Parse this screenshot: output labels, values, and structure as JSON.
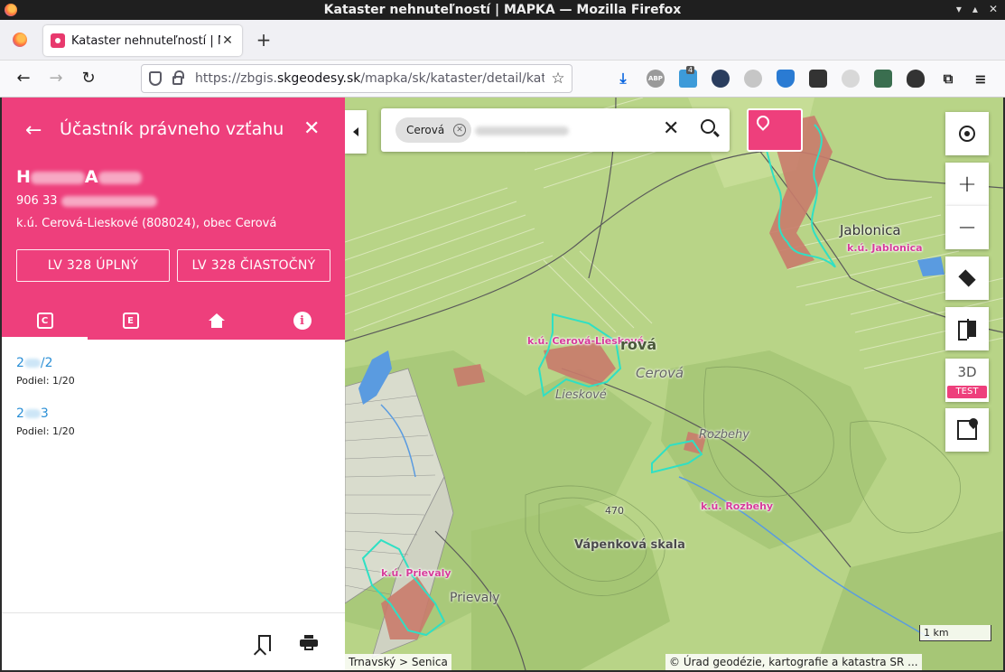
{
  "window": {
    "title": "Kataster nehnuteľností | MAPKA — Mozilla Firefox"
  },
  "browser": {
    "tab_title": "Kataster nehnuteľností | MAPKA",
    "url_prefix": "https://zbgis.",
    "url_domain": "skgeodesy.sk",
    "url_path": "/mapka/sk/kataster/detail/kataster/vlastnik",
    "extensions_badge": "4"
  },
  "panel": {
    "title": "Účastník právneho vzťahu",
    "owner_name_visible": "H          A",
    "postal_code": "906 33",
    "cadastral": "k.ú. Cerová-Lieskové (808024), obec Cerová",
    "btn_full": "LV 328 ÚPLNÝ",
    "btn_partial": "LV 328 ČIASTOČNÝ",
    "tabs": [
      {
        "label": "C",
        "icon": "c-register-icon"
      },
      {
        "label": "E",
        "icon": "e-register-icon"
      },
      {
        "label": "",
        "icon": "home-icon"
      },
      {
        "label": "i",
        "icon": "info-icon"
      }
    ],
    "parcels": [
      {
        "prefix": "2",
        "suffix": "/2",
        "share": "Podiel: 1/20"
      },
      {
        "prefix": "2",
        "suffix": "3",
        "share": "Podiel: 1/20"
      }
    ]
  },
  "map": {
    "search_chip": "Cerová",
    "btn_3d": "3D",
    "btn_3d_badge": "TEST",
    "scale": "1 km",
    "attribution_left": "Trnavský > Senica",
    "attribution_right": "© Úrad geodézie, kartografie a katastra SR ...",
    "labels": {
      "ku_jablonica": "k.ú. Jablonica",
      "ku_cerova": "k.ú. Cerová-Lieskové",
      "ku_rozbehy": "k.ú. Rozbehy",
      "ku_prievaly": "k.ú. Prievaly",
      "jablonica": "Jablonica",
      "cerova": "Cerová",
      "cerova_bold": "rová",
      "lieskove": "Lieskové",
      "rozbehy": "Rozbehy",
      "prievaly": "Prievaly",
      "vapenkova": "Vápenková skala",
      "elev_470": "470"
    },
    "colors": {
      "accent": "#ee3f7c",
      "boundary": "#2fe0c4",
      "label": "#d63b9a"
    }
  }
}
